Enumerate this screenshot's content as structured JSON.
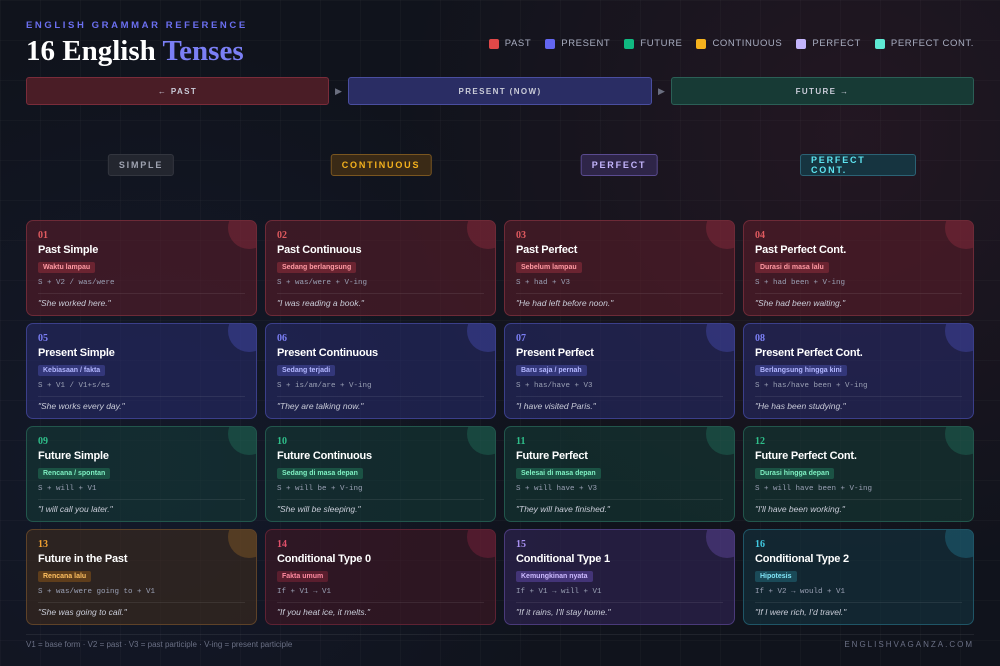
{
  "header": {
    "eyebrow": "ENGLISH GRAMMAR REFERENCE",
    "title_main": "16 English",
    "title_accent": "Tenses"
  },
  "legend": [
    {
      "label": "PAST",
      "color": "#e04848"
    },
    {
      "label": "PRESENT",
      "color": "#6366f1"
    },
    {
      "label": "FUTURE",
      "color": "#10b981"
    },
    {
      "label": "CONTINUOUS",
      "color": "#f5b21d"
    },
    {
      "label": "PERFECT",
      "color": "#c4b5fd"
    },
    {
      "label": "PERFECT CONT.",
      "color": "#5eead4"
    }
  ],
  "timeline": {
    "past": "← PAST",
    "present": "PRESENT (NOW)",
    "future": "FUTURE →",
    "arrow": "▶"
  },
  "categories": [
    "SIMPLE",
    "CONTINUOUS",
    "PERFECT",
    "PERFECT CONT."
  ],
  "cards": [
    {
      "num": "01",
      "name": "Past Simple",
      "tag": "Waktu lampau",
      "formula": "S + V2 / was/were",
      "example": "\"She worked here.\""
    },
    {
      "num": "02",
      "name": "Past Continuous",
      "tag": "Sedang berlangsung",
      "formula": "S + was/were + V-ing",
      "example": "\"I was reading a book.\""
    },
    {
      "num": "03",
      "name": "Past Perfect",
      "tag": "Sebelum lampau",
      "formula": "S + had + V3",
      "example": "\"He had left before noon.\""
    },
    {
      "num": "04",
      "name": "Past Perfect Cont.",
      "tag": "Durasi di masa lalu",
      "formula": "S + had been + V-ing",
      "example": "\"She had been waiting.\""
    },
    {
      "num": "05",
      "name": "Present Simple",
      "tag": "Kebiasaan / fakta",
      "formula": "S + V1 / V1+s/es",
      "example": "\"She works every day.\""
    },
    {
      "num": "06",
      "name": "Present Continuous",
      "tag": "Sedang terjadi",
      "formula": "S + is/am/are + V-ing",
      "example": "\"They are talking now.\""
    },
    {
      "num": "07",
      "name": "Present Perfect",
      "tag": "Baru saja / pernah",
      "formula": "S + has/have + V3",
      "example": "\"I have visited Paris.\""
    },
    {
      "num": "08",
      "name": "Present Perfect Cont.",
      "tag": "Berlangsung hingga kini",
      "formula": "S + has/have been + V-ing",
      "example": "\"He has been studying.\""
    },
    {
      "num": "09",
      "name": "Future Simple",
      "tag": "Rencana / spontan",
      "formula": "S + will + V1",
      "example": "\"I will call you later.\""
    },
    {
      "num": "10",
      "name": "Future Continuous",
      "tag": "Sedang di masa depan",
      "formula": "S + will be + V-ing",
      "example": "\"She will be sleeping.\""
    },
    {
      "num": "11",
      "name": "Future Perfect",
      "tag": "Selesai di masa depan",
      "formula": "S + will have + V3",
      "example": "\"They will have finished.\""
    },
    {
      "num": "12",
      "name": "Future Perfect Cont.",
      "tag": "Durasi hingga depan",
      "formula": "S + will have been + V-ing",
      "example": "\"I'll have been working.\""
    },
    {
      "num": "13",
      "name": "Future in the Past",
      "tag": "Rencana lalu",
      "formula": "S + was/were going to + V1",
      "example": "\"She was going to call.\""
    },
    {
      "num": "14",
      "name": "Conditional Type 0",
      "tag": "Fakta umum",
      "formula": "If + V1 → V1",
      "example": "\"If you heat ice, it melts.\""
    },
    {
      "num": "15",
      "name": "Conditional Type 1",
      "tag": "Kemungkinan nyata",
      "formula": "If + V1 → will + V1",
      "example": "\"If it rains, I'll stay home.\""
    },
    {
      "num": "16",
      "name": "Conditional Type 2",
      "tag": "Hipotesis",
      "formula": "If + V2 → would + V1",
      "example": "\"If I were rich, I'd travel.\""
    }
  ],
  "footer": {
    "legend_note": "V1 = base form · V2 = past · V3 = past participle · V-ing = present participle",
    "brand": "ENGLISHVAGANZA.COM"
  }
}
